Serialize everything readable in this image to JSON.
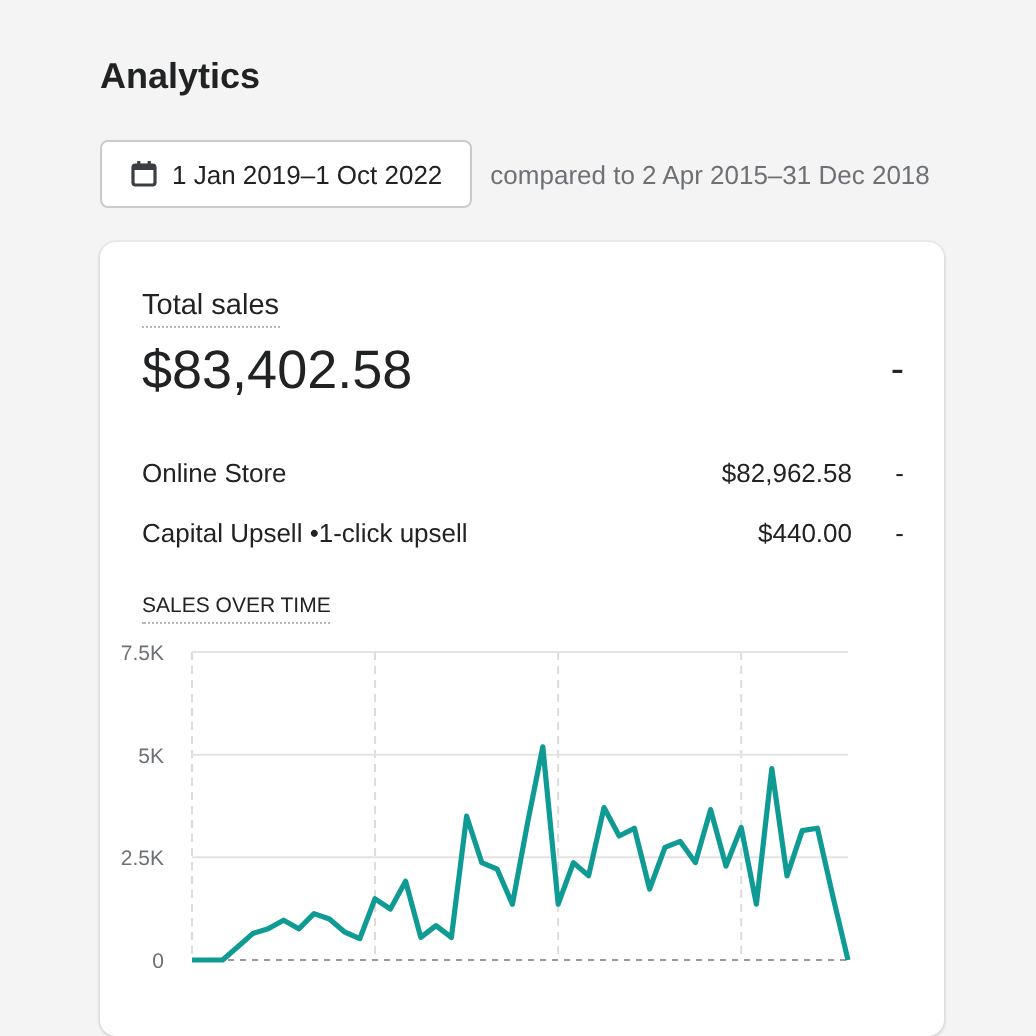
{
  "page": {
    "title": "Analytics"
  },
  "date_range": {
    "label": "1 Jan 2019–1 Oct 2022",
    "comparison": "compared to 2 Apr 2015–31 Dec 2018"
  },
  "card": {
    "title": "Total sales",
    "total": "$83,402.58",
    "change": "-",
    "rows": [
      {
        "label": "Online Store",
        "value": "$82,962.58",
        "change": "-"
      },
      {
        "label": "Capital Upsell •1-click upsell",
        "value": "$440.00",
        "change": "-"
      }
    ],
    "chart_title": "SALES OVER TIME",
    "chart_data": {
      "type": "line",
      "grid": true,
      "ylim": [
        0,
        7500
      ],
      "yticks": [
        {
          "value": 0,
          "label": "0"
        },
        {
          "value": 2500,
          "label": "2.5K"
        },
        {
          "value": 5000,
          "label": "5K"
        },
        {
          "value": 7500,
          "label": "7.5K"
        }
      ],
      "series": [
        {
          "color": "#0f9b94",
          "values": [
            0,
            0,
            0,
            320,
            650,
            760,
            970,
            760,
            1130,
            1000,
            680,
            520,
            1490,
            1240,
            1920,
            550,
            840,
            550,
            3500,
            2370,
            2210,
            1360,
            3340,
            5190,
            1360,
            2370,
            2050,
            3710,
            3020,
            3210,
            1730,
            2740,
            2890,
            2370,
            3660,
            2290,
            3230,
            1360,
            4660,
            2050,
            3150,
            3210,
            1560,
            0
          ]
        }
      ]
    }
  }
}
